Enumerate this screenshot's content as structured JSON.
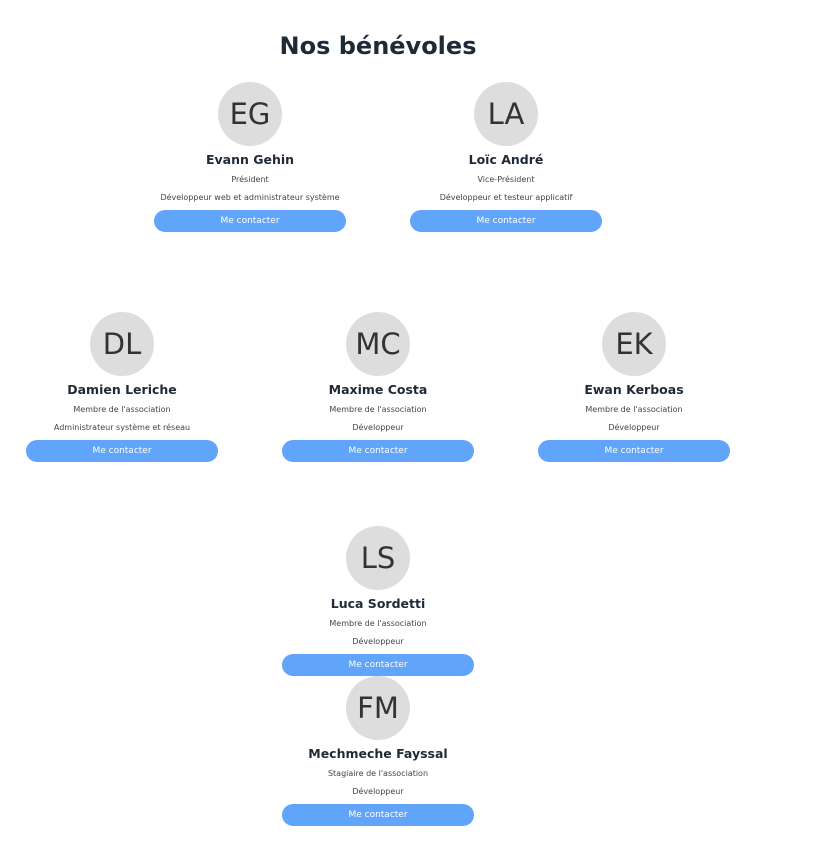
{
  "page": {
    "title": "Nos bénévoles"
  },
  "colors": {
    "button": "#60a5fa",
    "avatar_bg": "#dddddd",
    "heading": "#1f2937"
  },
  "volunteers": [
    {
      "initials": "EG",
      "name": "Evann Gehin",
      "role": "Président",
      "job": "Développeur web et administrateur système",
      "contact_label": "Me contacter"
    },
    {
      "initials": "LA",
      "name": "Loïc André",
      "role": "Vice-Président",
      "job": "Développeur et testeur applicatif",
      "contact_label": "Me contacter"
    },
    {
      "initials": "DL",
      "name": "Damien Leriche",
      "role": "Membre de l'association",
      "job": "Administrateur système et réseau",
      "contact_label": "Me contacter"
    },
    {
      "initials": "MC",
      "name": "Maxime Costa",
      "role": "Membre de l'association",
      "job": "Développeur",
      "contact_label": "Me contacter"
    },
    {
      "initials": "EK",
      "name": "Ewan Kerboas",
      "role": "Membre de l'association",
      "job": "Développeur",
      "contact_label": "Me contacter"
    },
    {
      "initials": "LS",
      "name": "Luca Sordetti",
      "role": "Membre de l'association",
      "job": "Développeur",
      "contact_label": "Me contacter"
    },
    {
      "initials": "FM",
      "name": "Mechmeche Fayssal",
      "role": "Stagiaire de l'association",
      "job": "Développeur",
      "contact_label": "Me contacter"
    }
  ]
}
